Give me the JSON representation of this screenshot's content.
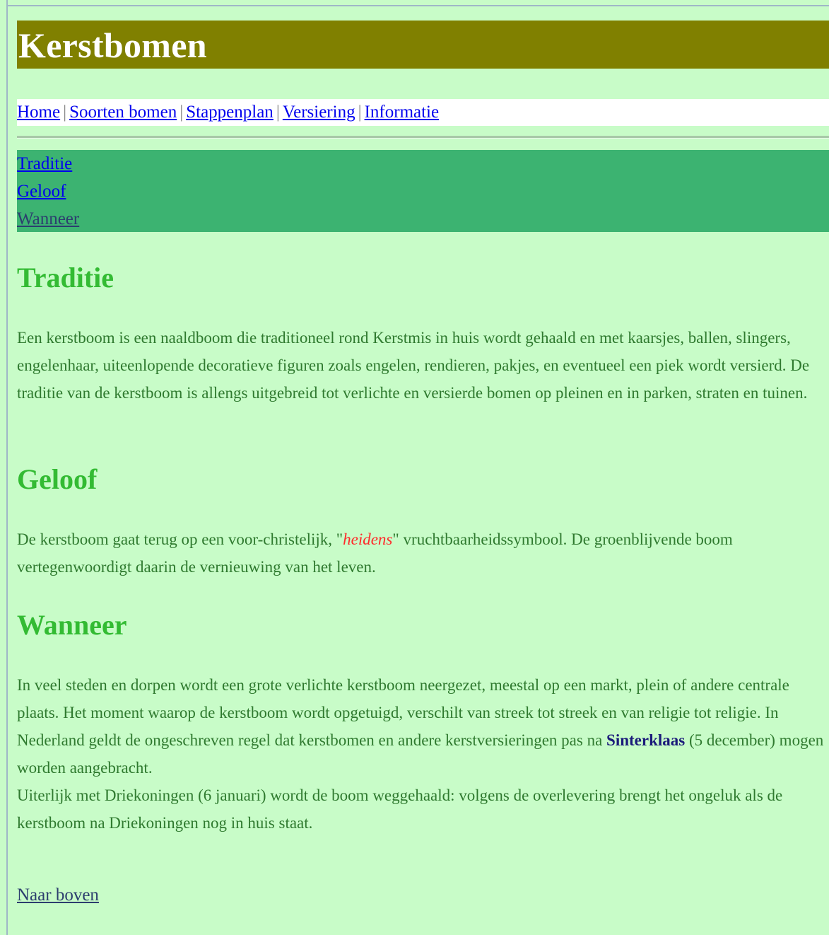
{
  "site": {
    "title": "Kerstbomen"
  },
  "topnav": {
    "items": [
      "Home",
      "Soorten bomen",
      "Stappenplan",
      "Versiering",
      "Informatie"
    ],
    "separator": "|"
  },
  "subnav": {
    "items": [
      "Traditie",
      "Geloof",
      "Wanneer"
    ]
  },
  "sections": {
    "traditie": {
      "heading": "Traditie",
      "text": "Een kerstboom is een naaldboom die traditioneel rond Kerstmis in huis wordt gehaald en met kaarsjes, ballen, slingers, engelenhaar, uiteenlopende decoratieve figuren zoals engelen, rendieren, pakjes, en eventueel een piek wordt versierd. De traditie van de kerstboom is allengs uitgebreid tot verlichte en versierde bomen op pleinen en in parken, straten en tuinen."
    },
    "geloof": {
      "heading": "Geloof",
      "text_before": "De kerstboom gaat terug op een voor-christelijk, \"",
      "emphasis": "heidens",
      "text_after": "\" vruchtbaarheidssymbool. De groenblijvende boom vertegenwoordigt daarin de vernieuwing van het leven."
    },
    "wanneer": {
      "heading": "Wanneer",
      "text_before": "In veel steden en dorpen wordt een grote verlichte kerstboom neergezet, meestal op een markt, plein of andere centrale plaats. Het moment waarop de kerstboom wordt opgetuigd, verschilt van streek tot streek en van religie tot religie. In Nederland geldt de ongeschreven regel dat kerstbomen en andere kerstversieringen pas na ",
      "emphasis": "Sinterklaas",
      "text_after": " (5 december) mogen worden aangebracht.",
      "text_second": "Uiterlijk met Driekoningen (6 januari) wordt de boom weggehaald: volgens de overlevering brengt het ongeluk als de kerstboom na Driekoningen nog in huis staat."
    }
  },
  "footer": {
    "back_link": "Naar boven"
  },
  "colors": {
    "page_background": "#c8fcc8",
    "header_background": "#808000",
    "subnav_background": "#3cb371",
    "heading_color": "#33bb33",
    "body_text": "#2f7a2f",
    "link": "#0000ee",
    "visited_link": "#2c3e6e",
    "emphasis_red": "#ff2a2a"
  }
}
